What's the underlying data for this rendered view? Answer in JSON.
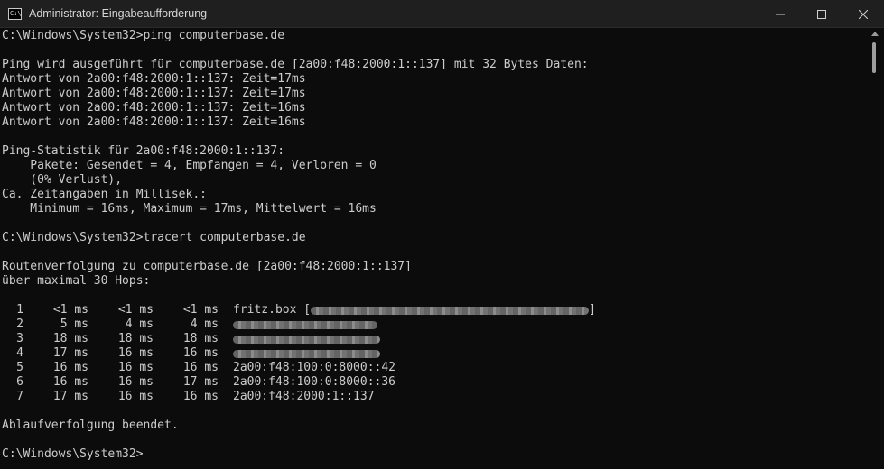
{
  "window": {
    "title": "Administrator: Eingabeaufforderung",
    "icon_text": "C:\\",
    "controls": [
      "minimize-icon",
      "maximize-icon",
      "close-icon"
    ]
  },
  "console": {
    "lines": [
      "C:\\Windows\\System32>ping computerbase.de",
      "",
      "Ping wird ausgeführt für computerbase.de [2a00:f48:2000:1::137] mit 32 Bytes Daten:",
      "Antwort von 2a00:f48:2000:1::137: Zeit=17ms",
      "Antwort von 2a00:f48:2000:1::137: Zeit=17ms",
      "Antwort von 2a00:f48:2000:1::137: Zeit=16ms",
      "Antwort von 2a00:f48:2000:1::137: Zeit=16ms",
      "",
      "Ping-Statistik für 2a00:f48:2000:1::137:",
      "    Pakete: Gesendet = 4, Empfangen = 4, Verloren = 0",
      "    (0% Verlust),",
      "Ca. Zeitangaben in Millisek.:",
      "    Minimum = 16ms, Maximum = 17ms, Mittelwert = 16ms",
      "",
      "C:\\Windows\\System32>tracert computerbase.de",
      "",
      "Routenverfolgung zu computerbase.de [2a00:f48:2000:1::137]",
      "über maximal 30 Hops:",
      ""
    ],
    "hops": [
      {
        "n": "1",
        "t1": "<1 ms",
        "t2": "<1 ms",
        "t3": "<1 ms",
        "host": "fritz.box [",
        "host_end": "]",
        "redacted": true
      },
      {
        "n": "2",
        "t1": "5 ms",
        "t2": "4 ms",
        "t3": "4 ms",
        "host": "",
        "host_end": "",
        "redacted": true
      },
      {
        "n": "3",
        "t1": "18 ms",
        "t2": "18 ms",
        "t3": "18 ms",
        "host": "",
        "host_end": "",
        "redacted": true
      },
      {
        "n": "4",
        "t1": "17 ms",
        "t2": "16 ms",
        "t3": "16 ms",
        "host": "",
        "host_end": "",
        "redacted": true
      },
      {
        "n": "5",
        "t1": "16 ms",
        "t2": "16 ms",
        "t3": "16 ms",
        "host": "2a00:f48:100:0:8000::42",
        "host_end": "",
        "redacted": false
      },
      {
        "n": "6",
        "t1": "16 ms",
        "t2": "16 ms",
        "t3": "17 ms",
        "host": "2a00:f48:100:0:8000::36",
        "host_end": "",
        "redacted": false
      },
      {
        "n": "7",
        "t1": "17 ms",
        "t2": "16 ms",
        "t3": "16 ms",
        "host": "2a00:f48:2000:1::137",
        "host_end": "",
        "redacted": false
      }
    ],
    "after_lines": [
      "",
      "Ablaufverfolgung beendet.",
      "",
      "C:\\Windows\\System32>"
    ]
  },
  "colors": {
    "background": "#0c0c0c",
    "titlebar": "#1f1f1f",
    "text": "#cccccc"
  }
}
